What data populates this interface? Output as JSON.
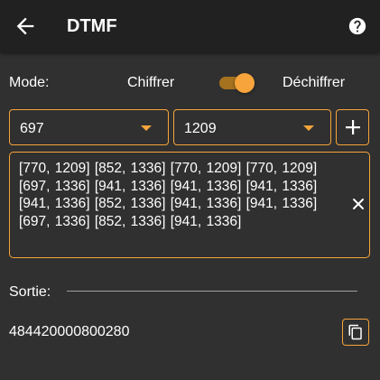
{
  "header": {
    "title": "DTMF",
    "back_icon": "arrow-left-icon",
    "help_icon": "help-circle-icon"
  },
  "mode": {
    "label": "Mode:",
    "option_cipher": "Chiffrer",
    "option_decipher": "Déchiffrer",
    "selected": "Déchiffrer"
  },
  "frequency_selectors": {
    "low": {
      "value": "697"
    },
    "high": {
      "value": "1209"
    },
    "add_icon": "plus-icon"
  },
  "input": {
    "value": "[770, 1209]   [852, 1336]   [770, 1209]   [770, 1209]   [697, 1336]   [941, 1336]   [941, 1336]   [941, 1336]   [941, 1336]   [852, 1336]   [941, 1336]   [941, 1336]   [697, 1336]   [852, 1336]   [941, 1336]",
    "clear_icon": "close-icon"
  },
  "output": {
    "label": "Sortie:",
    "value": "484420000800280",
    "copy_icon": "copy-icon"
  },
  "colors": {
    "accent": "#f6a43b",
    "toggle_track": "#a6721f",
    "background": "#303030",
    "appbar": "#212121",
    "text": "#ffffff",
    "divider": "#9e9e9e"
  }
}
